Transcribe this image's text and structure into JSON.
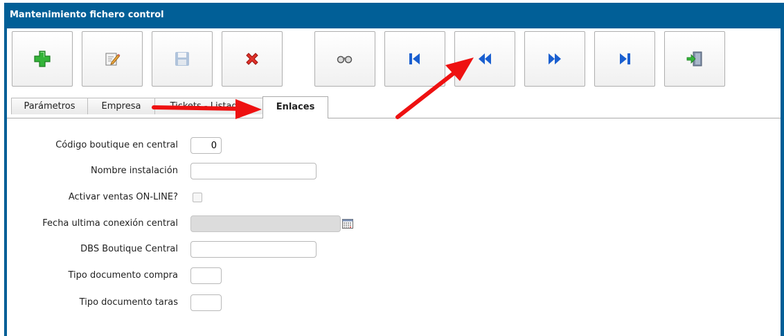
{
  "window": {
    "title": "Mantenimiento fichero control"
  },
  "toolbar": {
    "buttons": [
      {
        "name": "add-button",
        "icon": "plus-icon"
      },
      {
        "name": "edit-button",
        "icon": "edit-note-icon"
      },
      {
        "name": "save-button",
        "icon": "floppy-disk-icon",
        "disabled": true
      },
      {
        "name": "delete-button",
        "icon": "red-x-icon"
      },
      {
        "name": "search-button",
        "icon": "binoculars-icon"
      },
      {
        "name": "first-record-button",
        "icon": "first-record-icon"
      },
      {
        "name": "previous-record-button",
        "icon": "previous-record-icon"
      },
      {
        "name": "next-record-button",
        "icon": "next-record-icon"
      },
      {
        "name": "last-record-button",
        "icon": "last-record-icon"
      },
      {
        "name": "exit-button",
        "icon": "exit-door-icon"
      }
    ]
  },
  "tabs": [
    {
      "label": "Parámetros",
      "active": false
    },
    {
      "label": "Empresa",
      "active": false
    },
    {
      "label": "Tickets - Listados",
      "active": false
    },
    {
      "label": "Enlaces",
      "active": true
    }
  ],
  "form": {
    "codigo_label": "Código boutique en central",
    "codigo_value": "0",
    "nombre_label": "Nombre instalación",
    "nombre_value": "",
    "activar_label": "Activar ventas ON-LINE?",
    "activar_checked": false,
    "fecha_label": "Fecha ultima conexión central",
    "fecha_value": "",
    "dbs_label": "DBS Boutique Central",
    "dbs_value": "",
    "compra_label": "Tipo documento compra",
    "compra_value": "",
    "taras_label": "Tipo documento taras",
    "taras_value": ""
  },
  "colors": {
    "title_bar": "#015f97",
    "annotation_arrow": "#ee1111",
    "nav_arrow_blue": "#1a5fd0",
    "add_green": "#35b43a",
    "delete_red": "#e0322a"
  }
}
